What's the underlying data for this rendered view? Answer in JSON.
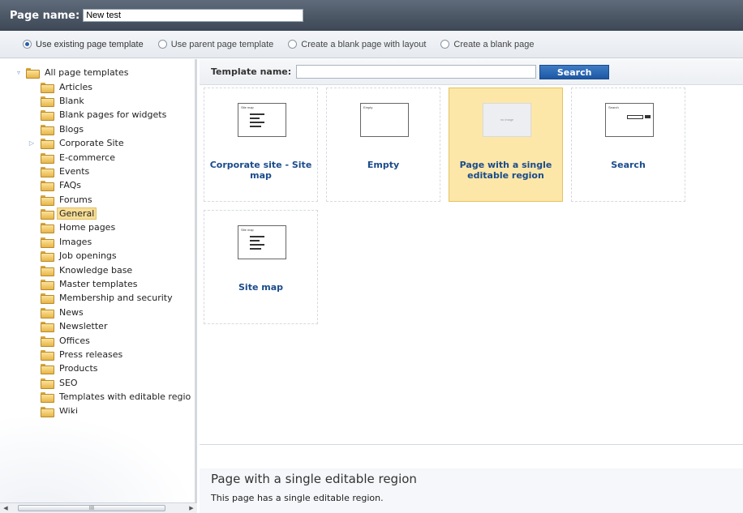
{
  "header": {
    "page_name_label": "Page name:",
    "page_name_value": "New test"
  },
  "template_options": [
    {
      "label": "Use existing page template",
      "checked": true
    },
    {
      "label": "Use parent page template",
      "checked": false
    },
    {
      "label": "Create a blank page with layout",
      "checked": false
    },
    {
      "label": "Create a blank page",
      "checked": false
    }
  ],
  "tree": {
    "root_label": "All page templates",
    "items": [
      {
        "label": "Articles"
      },
      {
        "label": "Blank"
      },
      {
        "label": "Blank pages for widgets"
      },
      {
        "label": "Blogs"
      },
      {
        "label": "Corporate Site",
        "expandable": true
      },
      {
        "label": "E-commerce"
      },
      {
        "label": "Events"
      },
      {
        "label": "FAQs"
      },
      {
        "label": "Forums"
      },
      {
        "label": "General",
        "selected": true
      },
      {
        "label": "Home pages"
      },
      {
        "label": "Images"
      },
      {
        "label": "Job openings"
      },
      {
        "label": "Knowledge base"
      },
      {
        "label": "Master templates"
      },
      {
        "label": "Membership and security"
      },
      {
        "label": "News"
      },
      {
        "label": "Newsletter"
      },
      {
        "label": "Offices"
      },
      {
        "label": "Press releases"
      },
      {
        "label": "Products"
      },
      {
        "label": "SEO"
      },
      {
        "label": "Templates with editable regio"
      },
      {
        "label": "Wiki"
      }
    ]
  },
  "scrollbar": {
    "thumb_glyph": "III"
  },
  "search": {
    "label": "Template name:",
    "value": "",
    "button_label": "Search"
  },
  "templates": [
    {
      "name": "Corporate site - Site map",
      "thumb_caption": "Site map",
      "thumb": "list",
      "selected": false
    },
    {
      "name": "Empty",
      "thumb_caption": "Empty",
      "thumb": "empty",
      "selected": false
    },
    {
      "name": "Page with a single editable region",
      "thumb_caption": "no image",
      "thumb": "noimage",
      "selected": true
    },
    {
      "name": "Search",
      "thumb_caption": "Search",
      "thumb": "search",
      "selected": false
    },
    {
      "name": "Site map",
      "thumb_caption": "Site map",
      "thumb": "list",
      "selected": false
    }
  ],
  "description": {
    "title": "Page with a single editable region",
    "text": "This page has a single editable region."
  }
}
